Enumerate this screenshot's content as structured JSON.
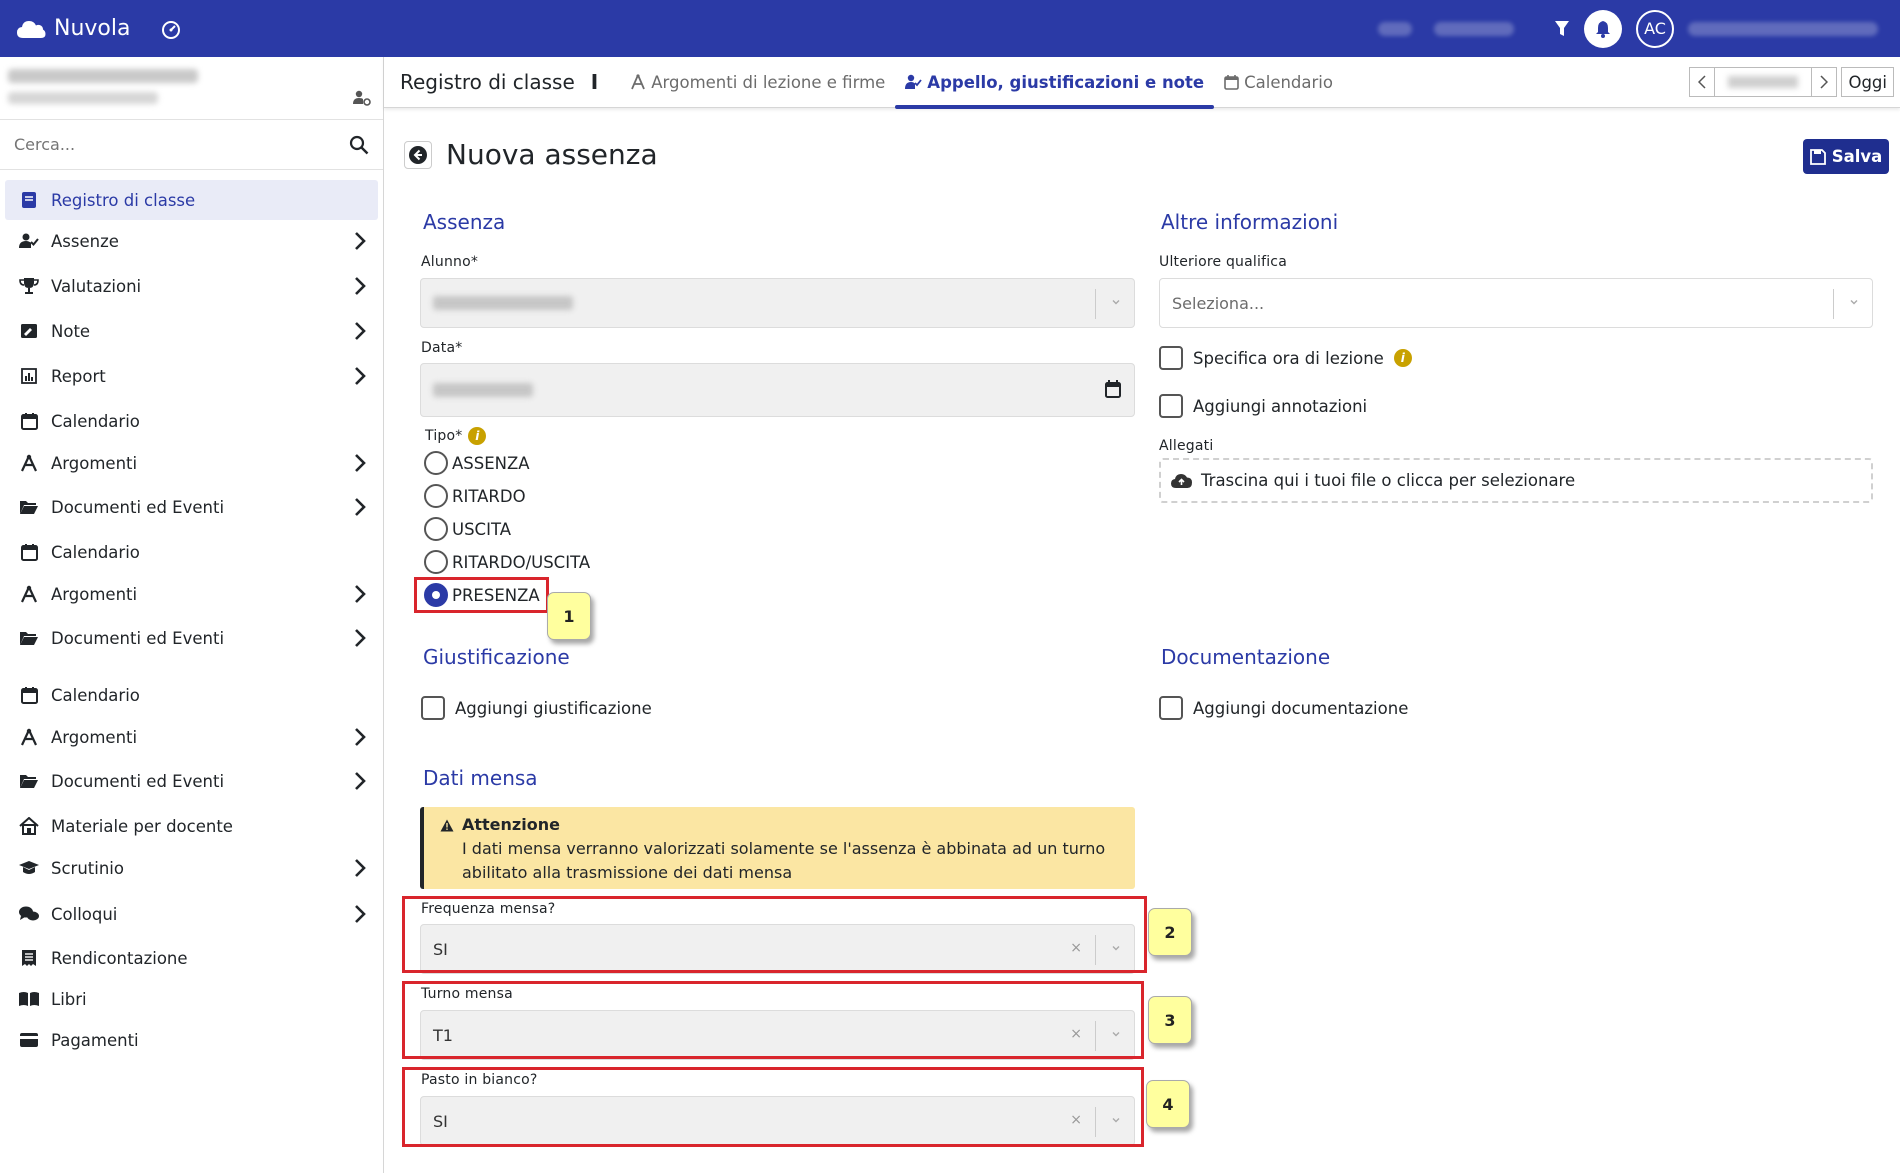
{
  "app": {
    "title": "Nuvola",
    "avatar_initials": "AC"
  },
  "sidebar": {
    "search_placeholder": "Cerca...",
    "items": [
      {
        "label": "Registro di classe",
        "icon": "book-icon",
        "chevron": false,
        "active": true
      },
      {
        "label": "Assenze",
        "icon": "user-check-icon",
        "chevron": true
      },
      {
        "label": "Valutazioni",
        "icon": "trophy-icon",
        "chevron": true
      },
      {
        "label": "Note",
        "icon": "note-icon",
        "chevron": true
      },
      {
        "label": "Report",
        "icon": "chart-icon",
        "chevron": true
      },
      {
        "label": "Calendario",
        "icon": "calendar-icon",
        "chevron": false
      },
      {
        "label": "Argomenti",
        "icon": "compass-icon",
        "chevron": true
      },
      {
        "label": "Documenti ed Eventi",
        "icon": "folder-icon",
        "chevron": true
      },
      {
        "label": "Calendario",
        "icon": "calendar-icon",
        "chevron": false
      },
      {
        "label": "Argomenti",
        "icon": "compass-icon",
        "chevron": true
      },
      {
        "label": "Documenti ed Eventi",
        "icon": "folder-icon",
        "chevron": true
      },
      {
        "label": "Calendario",
        "icon": "calendar-icon",
        "chevron": false
      },
      {
        "label": "Argomenti",
        "icon": "compass-icon",
        "chevron": true
      },
      {
        "label": "Documenti ed Eventi",
        "icon": "folder-icon",
        "chevron": true
      },
      {
        "label": "Materiale per docente",
        "icon": "house-icon",
        "chevron": false
      },
      {
        "label": "Scrutinio",
        "icon": "graduation-cap-icon",
        "chevron": true
      },
      {
        "label": "Colloqui",
        "icon": "chat-icon",
        "chevron": true
      },
      {
        "label": "Rendicontazione",
        "icon": "receipt-icon",
        "chevron": false
      },
      {
        "label": "Libri",
        "icon": "open-book-icon",
        "chevron": false
      },
      {
        "label": "Pagamenti",
        "icon": "credit-card-icon",
        "chevron": false
      }
    ]
  },
  "header": {
    "title": "Registro di classe",
    "separator": "I",
    "tabs": [
      {
        "label": "Argomenti di lezione e firme",
        "active": false
      },
      {
        "label": "Appello, giustificazioni e note",
        "active": true
      },
      {
        "label": "Calendario",
        "active": false
      }
    ],
    "today_label": "Oggi"
  },
  "page": {
    "title": "Nuova assenza",
    "save_label": "Salva"
  },
  "assenza": {
    "section_title": "Assenza",
    "alunno_label": "Alunno*",
    "data_label": "Data*",
    "tipo_label": "Tipo*",
    "tipo_options": [
      "ASSENZA",
      "RITARDO",
      "USCITA",
      "RITARDO/USCITA",
      "PRESENZA"
    ],
    "tipo_selected": "PRESENZA"
  },
  "altre": {
    "section_title": "Altre informazioni",
    "qualifica_label": "Ulteriore qualifica",
    "qualifica_placeholder": "Seleziona...",
    "ora_label": "Specifica ora di lezione",
    "annotazioni_label": "Aggiungi annotazioni",
    "allegati_label": "Allegati",
    "dropzone_text": "Trascina qui i tuoi file o clicca per selezionare"
  },
  "giustificazione": {
    "section_title": "Giustificazione",
    "check_label": "Aggiungi giustificazione"
  },
  "documentazione": {
    "section_title": "Documentazione",
    "check_label": "Aggiungi documentazione"
  },
  "mensa": {
    "section_title": "Dati mensa",
    "alert_title": "Attenzione",
    "alert_line1": "I dati mensa verranno valorizzati solamente se l'assenza è abbinata ad un turno",
    "alert_line2": "abilitato alla trasmissione dei dati mensa",
    "frequenza_label": "Frequenza mensa?",
    "frequenza_value": "SI",
    "turno_label": "Turno mensa",
    "turno_value": "T1",
    "pasto_label": "Pasto in bianco?",
    "pasto_value": "SI",
    "clear_glyph": "×"
  },
  "annotations": {
    "b1": "1",
    "b2": "2",
    "b3": "3",
    "b4": "4"
  },
  "colors": {
    "primary": "#2b3aa6",
    "highlight": "#d9252c",
    "badge": "#ffff9e",
    "alert": "#fbe6a3"
  }
}
